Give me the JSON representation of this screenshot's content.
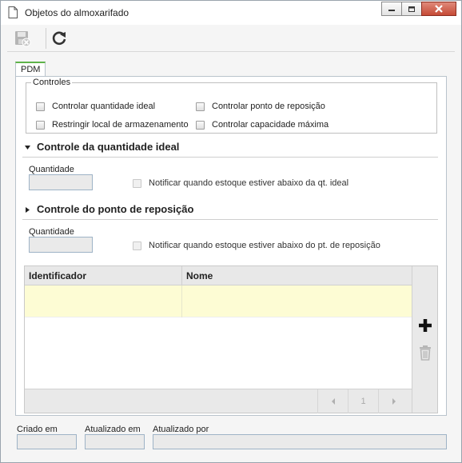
{
  "window": {
    "title": "Objetos do almoxarifado",
    "controls": [
      "minimize-icon",
      "maximize-icon",
      "close-icon"
    ]
  },
  "toolbar": {
    "buttons": [
      {
        "name": "save-close-button",
        "icon": "save-disabled-icon",
        "enabled": false
      },
      {
        "name": "refresh-button",
        "icon": "refresh-icon",
        "enabled": true
      }
    ]
  },
  "tabs": [
    {
      "label": "PDM",
      "active": true
    }
  ],
  "controles": {
    "legend": "Controles",
    "options": {
      "qtd_ideal": "Controlar quantidade ideal",
      "ponto_reposicao": "Controlar ponto de reposição",
      "restringir_local": "Restringir local de armazenamento",
      "capacidade_maxima": "Controlar capacidade máxima"
    }
  },
  "secao_qtd_ideal": {
    "title": "Controle da quantidade ideal",
    "expanded": true,
    "quantidade_label": "Quantidade",
    "quantidade_value": "",
    "notificar_label": "Notificar quando estoque estiver abaixo da qt. ideal"
  },
  "secao_ponto_reposicao": {
    "title": "Controle do ponto de reposição",
    "expanded": false,
    "quantidade_label": "Quantidade",
    "quantidade_value": "",
    "notificar_label": "Notificar quando estoque estiver abaixo do pt. de reposição"
  },
  "grid": {
    "columns": [
      "Identificador",
      "Nome"
    ],
    "rows": [
      {
        "identificador": "",
        "nome": ""
      }
    ],
    "pagination": {
      "page": "1"
    },
    "side_actions": [
      {
        "name": "add-button",
        "icon": "plus-icon"
      },
      {
        "name": "delete-button",
        "icon": "trash-icon"
      }
    ]
  },
  "footer": {
    "criado_em_label": "Criado em",
    "criado_em_value": "",
    "atualizado_em_label": "Atualizado em",
    "atualizado_em_value": "",
    "atualizado_por_label": "Atualizado por",
    "atualizado_por_value": ""
  },
  "colors": {
    "tab_accent": "#5fb34a",
    "selected_row": "#fdfcd4",
    "close_button": "#c54a36"
  }
}
